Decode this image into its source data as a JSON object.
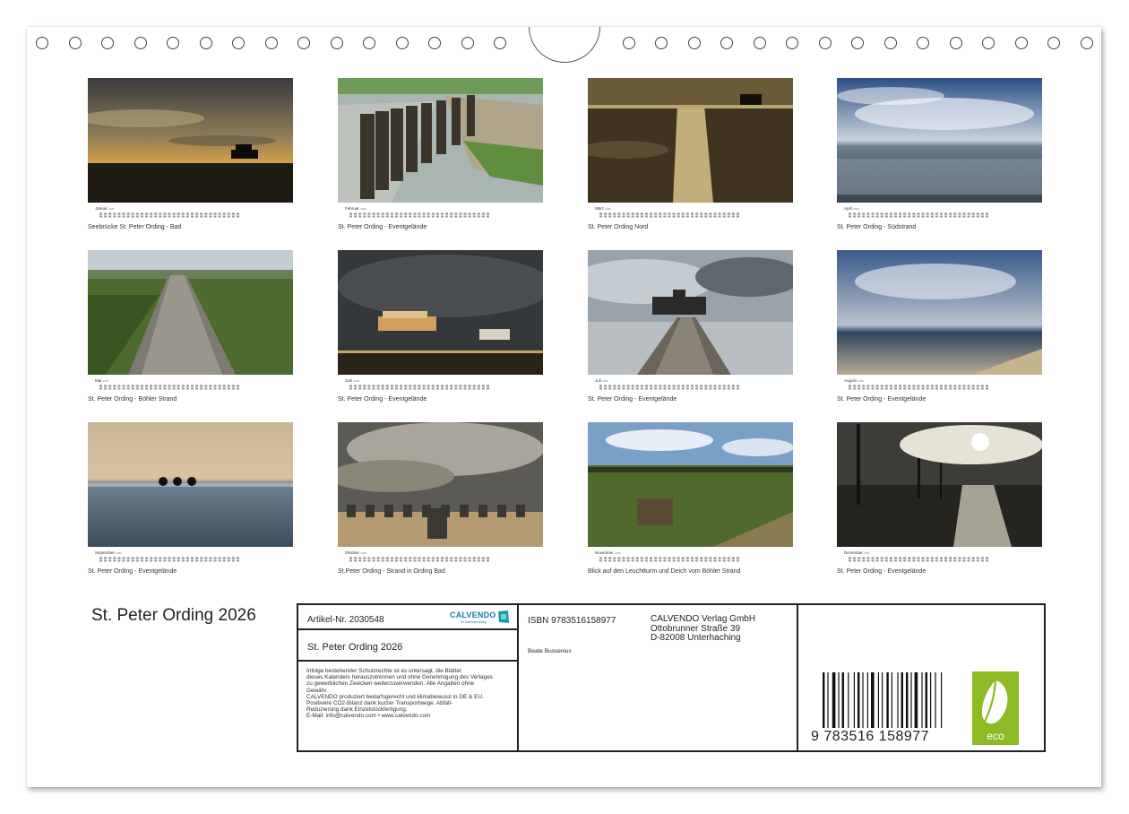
{
  "calendar_title": "St. Peter Ording 2026",
  "months": [
    {
      "name": "Januar",
      "year": "2026",
      "caption": "Seebrücke St. Peter Ording - Bad"
    },
    {
      "name": "Februar",
      "year": "2026",
      "caption": "St. Peter Ording - Eventgelände"
    },
    {
      "name": "März",
      "year": "2026",
      "caption": "St. Peter Ording Nord"
    },
    {
      "name": "April",
      "year": "2026",
      "caption": "St. Peter Ording - Südstrand"
    },
    {
      "name": "Mai",
      "year": "2026",
      "caption": "St. Peter Ording - Böhler Strand"
    },
    {
      "name": "Juni",
      "year": "2026",
      "caption": "St. Peter Ording - Eventgelände"
    },
    {
      "name": "Juli",
      "year": "2026",
      "caption": "St. Peter Ording - Eventgelände"
    },
    {
      "name": "August",
      "year": "2026",
      "caption": "St. Peter Ording - Eventgelände"
    },
    {
      "name": "September",
      "year": "2026",
      "caption": "St. Peter Ording - Eventgelände"
    },
    {
      "name": "Oktober",
      "year": "2026",
      "caption": "St.Peter Ording - Strand in Ording Bad"
    },
    {
      "name": "November",
      "year": "2026",
      "caption": "Blick auf den Leuchtturm und Deich vom Böhler Strand"
    },
    {
      "name": "Dezember",
      "year": "2026",
      "caption": "St. Peter Ording - Eventgelände"
    }
  ],
  "info": {
    "article": "Artikel-Nr. 2030548",
    "title": "St. Peter Ording 2026",
    "legal": "Infolge bestehender Schutzrechte ist es untersagt, die Blätter\ndieses Kalenders herauszutrennen und ohne Genehmigung des Verlages\nzu gewerblichen Zwecken weiterzuverwenden. Alle Angaben ohne\nGewähr.\nCALVENDO produziert bedarfsgerecht und klimabewusst in DE & EU.\nPositivere CO2-Bilanz dank kurzer Transportwege. Abfall-\nReduzierung dank Einzelstückfertigung.\nE-Mail: info@calvendo.com • www.calvendo.com",
    "isbn": "ISBN 9783516158977",
    "author": "Beate Bussenius",
    "publisher_lines": [
      "CALVENDO Verlag GmbH",
      "Ottobrunner Straße 39",
      "D-82008 Unterhaching"
    ],
    "barcode_digits": "9 783516 158977",
    "logo_brand": "CALVENDO",
    "logo_tagline": "Ihr Kalenderverlag",
    "eco_label": "eco"
  }
}
